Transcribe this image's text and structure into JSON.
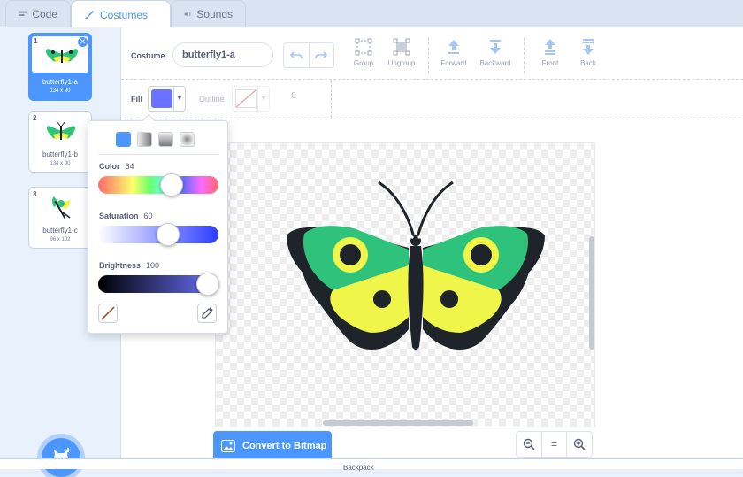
{
  "tabs": [
    {
      "label": "Code",
      "icon": "code-icon"
    },
    {
      "label": "Costumes",
      "icon": "brush-icon"
    },
    {
      "label": "Sounds",
      "icon": "speaker-icon"
    }
  ],
  "costumes": [
    {
      "number": "1",
      "name": "butterfly1-a",
      "size": "134 x 90",
      "selected": true
    },
    {
      "number": "2",
      "name": "butterfly1-b",
      "size": "134 x 90",
      "selected": false
    },
    {
      "number": "3",
      "name": "butterfly1-c",
      "size": "96 x 102",
      "selected": false
    }
  ],
  "toolbar": {
    "costume_label": "Costume",
    "costume_name": "butterfly1-a",
    "group": "Group",
    "ungroup": "Ungroup",
    "forward": "Forward",
    "backward": "Backward",
    "front": "Front",
    "back": "Back",
    "fill_label": "Fill",
    "outline_label": "Outline",
    "outline_width": "0"
  },
  "fill_color": "#6a72ff",
  "color_picker": {
    "color_label": "Color",
    "color_value": "64",
    "saturation_label": "Saturation",
    "saturation_value": "60",
    "brightness_label": "Brightness",
    "brightness_value": "100"
  },
  "convert_button": "Convert to Bitmap",
  "zoom": {
    "zoom_out": "−",
    "reset": "=",
    "zoom_in": "+"
  },
  "bottom": {
    "text": "Backpack"
  },
  "colors": {
    "accent": "#4c97ff",
    "toolbar_purple": "#855cd6",
    "butterfly_green": "#2fc27a",
    "butterfly_yellow": "#f0f54a",
    "butterfly_dark": "#1f242b"
  }
}
